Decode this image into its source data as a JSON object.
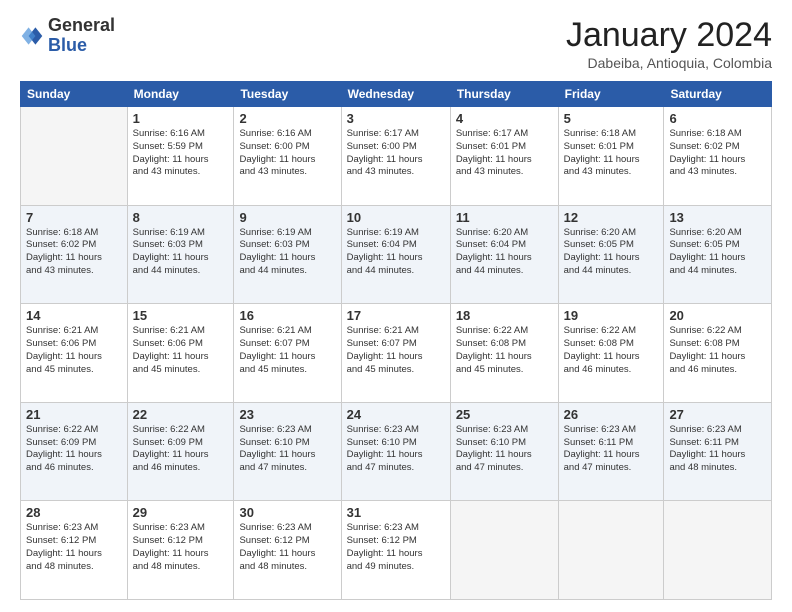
{
  "header": {
    "logo_general": "General",
    "logo_blue": "Blue",
    "month_title": "January 2024",
    "location": "Dabeiba, Antioquia, Colombia"
  },
  "days_of_week": [
    "Sunday",
    "Monday",
    "Tuesday",
    "Wednesday",
    "Thursday",
    "Friday",
    "Saturday"
  ],
  "weeks": [
    [
      {
        "day": "",
        "info": ""
      },
      {
        "day": "1",
        "info": "Sunrise: 6:16 AM\nSunset: 5:59 PM\nDaylight: 11 hours\nand 43 minutes."
      },
      {
        "day": "2",
        "info": "Sunrise: 6:16 AM\nSunset: 6:00 PM\nDaylight: 11 hours\nand 43 minutes."
      },
      {
        "day": "3",
        "info": "Sunrise: 6:17 AM\nSunset: 6:00 PM\nDaylight: 11 hours\nand 43 minutes."
      },
      {
        "day": "4",
        "info": "Sunrise: 6:17 AM\nSunset: 6:01 PM\nDaylight: 11 hours\nand 43 minutes."
      },
      {
        "day": "5",
        "info": "Sunrise: 6:18 AM\nSunset: 6:01 PM\nDaylight: 11 hours\nand 43 minutes."
      },
      {
        "day": "6",
        "info": "Sunrise: 6:18 AM\nSunset: 6:02 PM\nDaylight: 11 hours\nand 43 minutes."
      }
    ],
    [
      {
        "day": "7",
        "info": "Sunrise: 6:18 AM\nSunset: 6:02 PM\nDaylight: 11 hours\nand 43 minutes."
      },
      {
        "day": "8",
        "info": "Sunrise: 6:19 AM\nSunset: 6:03 PM\nDaylight: 11 hours\nand 44 minutes."
      },
      {
        "day": "9",
        "info": "Sunrise: 6:19 AM\nSunset: 6:03 PM\nDaylight: 11 hours\nand 44 minutes."
      },
      {
        "day": "10",
        "info": "Sunrise: 6:19 AM\nSunset: 6:04 PM\nDaylight: 11 hours\nand 44 minutes."
      },
      {
        "day": "11",
        "info": "Sunrise: 6:20 AM\nSunset: 6:04 PM\nDaylight: 11 hours\nand 44 minutes."
      },
      {
        "day": "12",
        "info": "Sunrise: 6:20 AM\nSunset: 6:05 PM\nDaylight: 11 hours\nand 44 minutes."
      },
      {
        "day": "13",
        "info": "Sunrise: 6:20 AM\nSunset: 6:05 PM\nDaylight: 11 hours\nand 44 minutes."
      }
    ],
    [
      {
        "day": "14",
        "info": "Sunrise: 6:21 AM\nSunset: 6:06 PM\nDaylight: 11 hours\nand 45 minutes."
      },
      {
        "day": "15",
        "info": "Sunrise: 6:21 AM\nSunset: 6:06 PM\nDaylight: 11 hours\nand 45 minutes."
      },
      {
        "day": "16",
        "info": "Sunrise: 6:21 AM\nSunset: 6:07 PM\nDaylight: 11 hours\nand 45 minutes."
      },
      {
        "day": "17",
        "info": "Sunrise: 6:21 AM\nSunset: 6:07 PM\nDaylight: 11 hours\nand 45 minutes."
      },
      {
        "day": "18",
        "info": "Sunrise: 6:22 AM\nSunset: 6:08 PM\nDaylight: 11 hours\nand 45 minutes."
      },
      {
        "day": "19",
        "info": "Sunrise: 6:22 AM\nSunset: 6:08 PM\nDaylight: 11 hours\nand 46 minutes."
      },
      {
        "day": "20",
        "info": "Sunrise: 6:22 AM\nSunset: 6:08 PM\nDaylight: 11 hours\nand 46 minutes."
      }
    ],
    [
      {
        "day": "21",
        "info": "Sunrise: 6:22 AM\nSunset: 6:09 PM\nDaylight: 11 hours\nand 46 minutes."
      },
      {
        "day": "22",
        "info": "Sunrise: 6:22 AM\nSunset: 6:09 PM\nDaylight: 11 hours\nand 46 minutes."
      },
      {
        "day": "23",
        "info": "Sunrise: 6:23 AM\nSunset: 6:10 PM\nDaylight: 11 hours\nand 47 minutes."
      },
      {
        "day": "24",
        "info": "Sunrise: 6:23 AM\nSunset: 6:10 PM\nDaylight: 11 hours\nand 47 minutes."
      },
      {
        "day": "25",
        "info": "Sunrise: 6:23 AM\nSunset: 6:10 PM\nDaylight: 11 hours\nand 47 minutes."
      },
      {
        "day": "26",
        "info": "Sunrise: 6:23 AM\nSunset: 6:11 PM\nDaylight: 11 hours\nand 47 minutes."
      },
      {
        "day": "27",
        "info": "Sunrise: 6:23 AM\nSunset: 6:11 PM\nDaylight: 11 hours\nand 48 minutes."
      }
    ],
    [
      {
        "day": "28",
        "info": "Sunrise: 6:23 AM\nSunset: 6:12 PM\nDaylight: 11 hours\nand 48 minutes."
      },
      {
        "day": "29",
        "info": "Sunrise: 6:23 AM\nSunset: 6:12 PM\nDaylight: 11 hours\nand 48 minutes."
      },
      {
        "day": "30",
        "info": "Sunrise: 6:23 AM\nSunset: 6:12 PM\nDaylight: 11 hours\nand 48 minutes."
      },
      {
        "day": "31",
        "info": "Sunrise: 6:23 AM\nSunset: 6:12 PM\nDaylight: 11 hours\nand 49 minutes."
      },
      {
        "day": "",
        "info": ""
      },
      {
        "day": "",
        "info": ""
      },
      {
        "day": "",
        "info": ""
      }
    ]
  ]
}
